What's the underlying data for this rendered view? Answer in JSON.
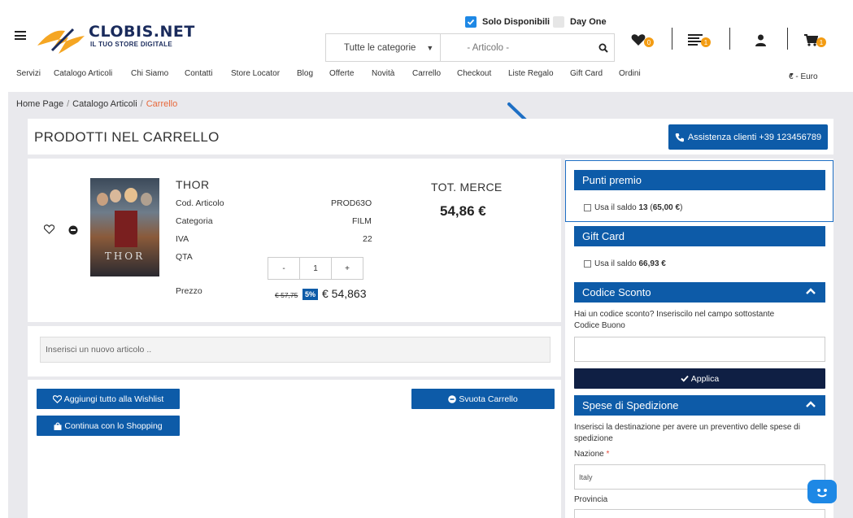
{
  "header": {
    "logo_text": "CLOBIS.NET",
    "logo_sub": "IL TUO STORE DIGITALE",
    "solo_disponibili": "Solo Disponibili",
    "day_one": "Day One",
    "category_select": "Tutte le categorie",
    "search_placeholder": "- Articolo -",
    "wishlist_count": "0",
    "list_count": "1",
    "cart_count": "1"
  },
  "nav": {
    "items": [
      "Servizi",
      "Catalogo Articoli",
      "Chi Siamo",
      "Contatti",
      "Store Locator",
      "Blog",
      "Offerte",
      "Novità",
      "Carrello",
      "Checkout",
      "Liste Regalo",
      "Gift Card",
      "Ordini"
    ],
    "currency": "€ - Euro"
  },
  "breadcrumb": {
    "home": "Home Page",
    "catalog": "Catalogo Articoli",
    "current": "Carrello"
  },
  "page": {
    "title": "PRODOTTI NEL CARRELLO",
    "assist_button": "Assistenza clienti +39 123456789"
  },
  "product": {
    "name": "THOR",
    "poster_label": "THOR",
    "rows": [
      {
        "label": "Cod. Articolo",
        "value": "PROD63O"
      },
      {
        "label": "Categoria",
        "value": "FILM"
      },
      {
        "label": "IVA",
        "value": "22"
      },
      {
        "label": "QTA",
        "value": ""
      }
    ],
    "qty_minus": "-",
    "qty_value": "1",
    "qty_plus": "+",
    "price_label": "Prezzo",
    "old_price": "€ 57,75",
    "discount": "5%",
    "new_price": "€ 54,863"
  },
  "totals": {
    "label": "TOT. MERCE",
    "value": "54,86 €"
  },
  "new_item": {
    "placeholder": "Inserisci un nuovo articolo .."
  },
  "actions": {
    "wishlist_all": "Aggiungi tutto alla Wishlist",
    "continue_shopping": "Continua con lo Shopping",
    "empty_cart": "Svuota Carrello"
  },
  "sidebar": {
    "punti_title": "Punti premio",
    "punti_check_prefix": "Usa il saldo",
    "punti_points": "13",
    "punti_amount": "65,00 €",
    "gift_title": "Gift Card",
    "gift_check_prefix": "Usa il saldo",
    "gift_amount": "66,93 €",
    "sconto_title": "Codice Sconto",
    "sconto_text": "Hai un codice sconto? Inseriscilo nel campo sottostante",
    "sconto_label": "Codice Buono",
    "apply_button": "Applica",
    "spedizione_title": "Spese di Spedizione",
    "spedizione_text": "Inserisci la destinazione per avere un preventivo delle spese di spedizione",
    "nazione_label": "Nazione",
    "nazione_value": "Italy",
    "provincia_label": "Provincia"
  }
}
